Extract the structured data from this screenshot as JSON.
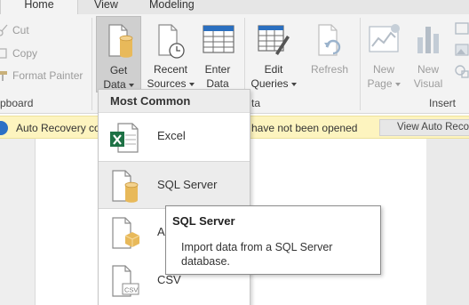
{
  "tabs": [
    {
      "label": "Home",
      "active": true
    },
    {
      "label": "View",
      "active": false
    },
    {
      "label": "Modeling",
      "active": false
    }
  ],
  "clipboard": {
    "cut": "Cut",
    "copy": "Copy",
    "format_painter": "Format Painter",
    "group_label": "pboard"
  },
  "external_data": {
    "get_data": {
      "line1": "Get",
      "line2": "Data"
    },
    "recent_sources": {
      "line1": "Recent",
      "line2": "Sources"
    },
    "enter_data": {
      "line1": "Enter",
      "line2": "Data"
    },
    "edit_queries": {
      "line1": "Edit",
      "line2": "Queries"
    },
    "refresh": {
      "line1": "Refresh"
    },
    "group_label_tail": "ta"
  },
  "insert": {
    "new_page": {
      "line1": "New",
      "line2": "Page"
    },
    "new_visual": {
      "line1": "New",
      "line2": "Visual"
    },
    "group_label": "Insert"
  },
  "notification": {
    "message_start": "Auto Recovery co",
    "message_end": "have not been opened",
    "button": "View Auto Recove"
  },
  "dropdown": {
    "header": "Most Common",
    "items": [
      {
        "label": "Excel",
        "icon": "excel-icon"
      },
      {
        "label": "SQL Server",
        "icon": "sql-server-icon",
        "hover": true
      },
      {
        "label": "An",
        "icon": "analysis-services-icon"
      },
      {
        "label": "CSV",
        "icon": "csv-icon"
      }
    ]
  },
  "tooltip": {
    "title": "SQL Server",
    "body": "Import data from a SQL Server database."
  },
  "colors": {
    "excel_green": "#1e7145",
    "db_gold": "#e8b95a",
    "notification_bg": "#fdf4bf",
    "info_blue": "#2b70c6",
    "disabled_icon_gray": "#b4bdc7"
  }
}
